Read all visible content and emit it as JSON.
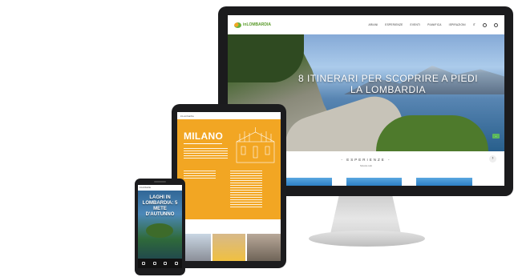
{
  "desktop": {
    "logo_text": "inLOMBARDIA",
    "nav": [
      "ARIANI",
      "ESPERIENZE",
      "EVENTI",
      "PIANIFICA",
      "ISPIRAZIONI",
      "IT"
    ],
    "hero_title": "8 ITINERARI PER SCOPRIRE A PIEDI LA LOMBARDIA",
    "experience_title": "- ESPERIENZE -",
    "experience_subtitle": "Mostra tutti"
  },
  "tablet": {
    "city_title": "MILANO",
    "header_text": "inLombardia"
  },
  "phone": {
    "header_text": "inLombardia",
    "hero_title": "LAGHI IN LOMBARDIA: 5 METE D'AUTUNNO"
  },
  "colors": {
    "accent_orange": "#f2a623",
    "brand_green": "#6cb33e",
    "device_frame": "#1b1b1d"
  }
}
